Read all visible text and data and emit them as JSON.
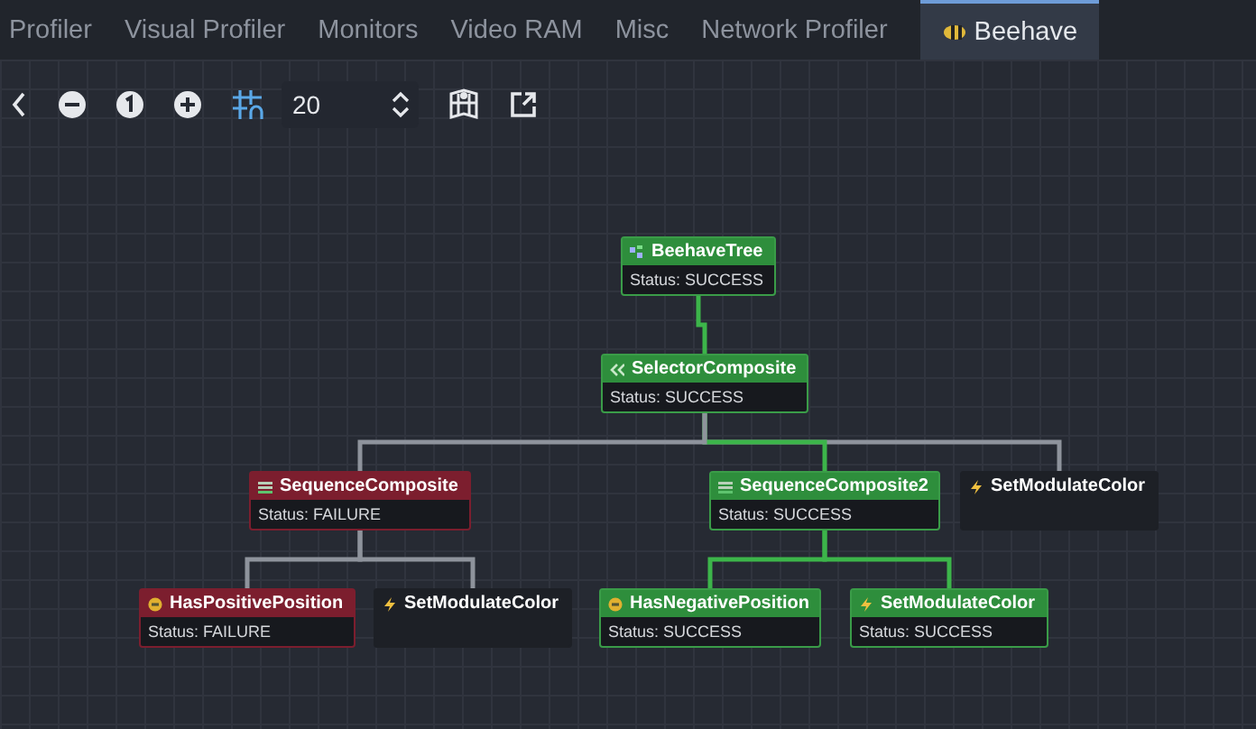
{
  "tabs": [
    {
      "label": "Profiler",
      "selected": false
    },
    {
      "label": "Visual Profiler",
      "selected": false
    },
    {
      "label": "Monitors",
      "selected": false
    },
    {
      "label": "Video RAM",
      "selected": false
    },
    {
      "label": "Misc",
      "selected": false
    },
    {
      "label": "Network Profiler",
      "selected": false
    },
    {
      "label": "Beehave",
      "selected": true
    }
  ],
  "toolbar": {
    "snap_distance": "20"
  },
  "tree": {
    "name": "BeehaveTree",
    "kind": "tree",
    "succeeded": true,
    "failed": false,
    "status_text": "Status: SUCCESS",
    "children": [
      {
        "name": "SelectorComposite",
        "kind": "selector",
        "succeeded": true,
        "failed": false,
        "status_text": "Status: SUCCESS",
        "children": [
          {
            "name": "SequenceComposite",
            "kind": "sequence",
            "succeeded": false,
            "failed": true,
            "status_text": "Status: FAILURE",
            "children": [
              {
                "name": "HasPositivePosition",
                "kind": "condition",
                "succeeded": false,
                "failed": true,
                "status_text": "Status: FAILURE"
              },
              {
                "name": "SetModulateColor",
                "kind": "action",
                "succeeded": false,
                "failed": false
              }
            ]
          },
          {
            "name": "SequenceComposite2",
            "kind": "sequence",
            "succeeded": true,
            "failed": false,
            "status_text": "Status: SUCCESS",
            "children": [
              {
                "name": "HasNegativePosition",
                "kind": "condition",
                "succeeded": true,
                "failed": false,
                "status_text": "Status: SUCCESS"
              },
              {
                "name": "SetModulateColor",
                "kind": "action",
                "succeeded": true,
                "failed": false,
                "status_text": "Status: SUCCESS"
              }
            ]
          },
          {
            "name": "SetModulateColor",
            "kind": "action",
            "succeeded": false,
            "failed": false
          }
        ]
      }
    ]
  }
}
